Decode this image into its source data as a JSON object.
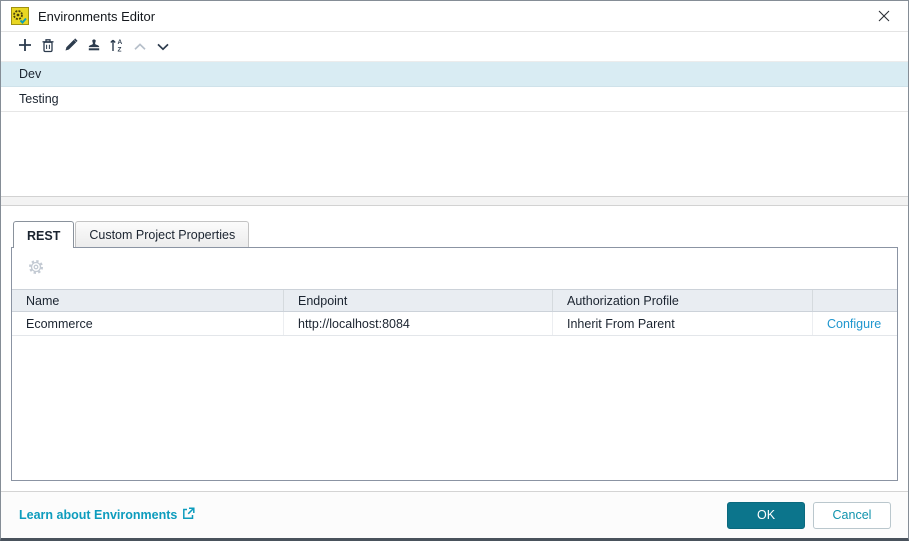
{
  "window": {
    "title": "Environments Editor"
  },
  "toolbar": {
    "buttons": [
      {
        "icon": "plus-icon",
        "action": "add-environment"
      },
      {
        "icon": "trash-icon",
        "action": "delete-environment"
      },
      {
        "icon": "pencil-icon",
        "action": "rename-environment"
      },
      {
        "icon": "stamp-icon",
        "action": "clone-environment"
      },
      {
        "icon": "sort-az-icon",
        "action": "sort-environments"
      },
      {
        "icon": "chevron-up-icon",
        "action": "move-up",
        "disabled": true
      },
      {
        "icon": "chevron-down-icon",
        "action": "move-down",
        "disabled": false
      }
    ]
  },
  "environments": [
    {
      "name": "Dev",
      "selected": true
    },
    {
      "name": "Testing",
      "selected": false
    }
  ],
  "tabs": [
    {
      "label": "REST",
      "active": true
    },
    {
      "label": "Custom Project Properties",
      "active": false
    }
  ],
  "panel_toolbar": {
    "buttons": [
      {
        "icon": "gear-icon",
        "action": "service-settings",
        "disabled": true
      }
    ]
  },
  "table": {
    "headers": [
      "Name",
      "Endpoint",
      "Authorization Profile"
    ],
    "rows": [
      {
        "name": "Ecommerce",
        "endpoint": "http://localhost:8084",
        "auth_profile": "Inherit From Parent",
        "action": "Configure"
      }
    ]
  },
  "footer": {
    "help_link": "Learn about Environments",
    "ok_label": "OK",
    "cancel_label": "Cancel"
  },
  "colors": {
    "ok_button": "#0c758c",
    "cancel_text": "#0f93ad",
    "configure_link": "#2097cf",
    "help_link": "#0d9cbd",
    "selected_row_bg": "#d9ecf3",
    "app_icon_bg": "#e9d622",
    "table_header_bg": "#e9edf2"
  }
}
